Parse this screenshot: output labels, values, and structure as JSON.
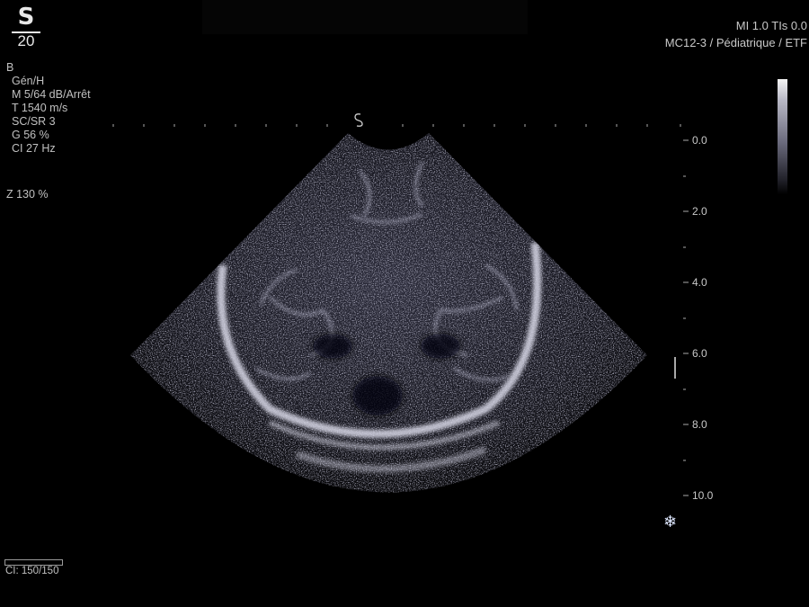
{
  "logo": {
    "letter": "S",
    "number": "20"
  },
  "header": {
    "mi_ti": "MI 1.0  TIs  0.0",
    "probe_preset": "MC12-3 / Pédiatrique / ETF"
  },
  "imaging_params": {
    "mode": "B",
    "gen": "Gén/H",
    "map": "M 5/64 dB/Arrêt",
    "speed": "T 1540 m/s",
    "compound": "SC/SR 3",
    "gain": "G 56 %",
    "frame_rate": "CI 27 Hz"
  },
  "zoom": "Z  130  %",
  "depth_scale": {
    "labels": [
      "0.0",
      "2.0",
      "4.0",
      "6.0",
      "8.0",
      "10.0"
    ],
    "unit": "cm"
  },
  "focus_marker": "focus-marker",
  "cine": {
    "text": "CI: 150/150",
    "fraction": 1.0
  },
  "freeze_icon": "snowflake-icon",
  "colors": {
    "background": "#000000",
    "text": "#c8c8c8",
    "tissue_tint": "#a7a7c4"
  }
}
